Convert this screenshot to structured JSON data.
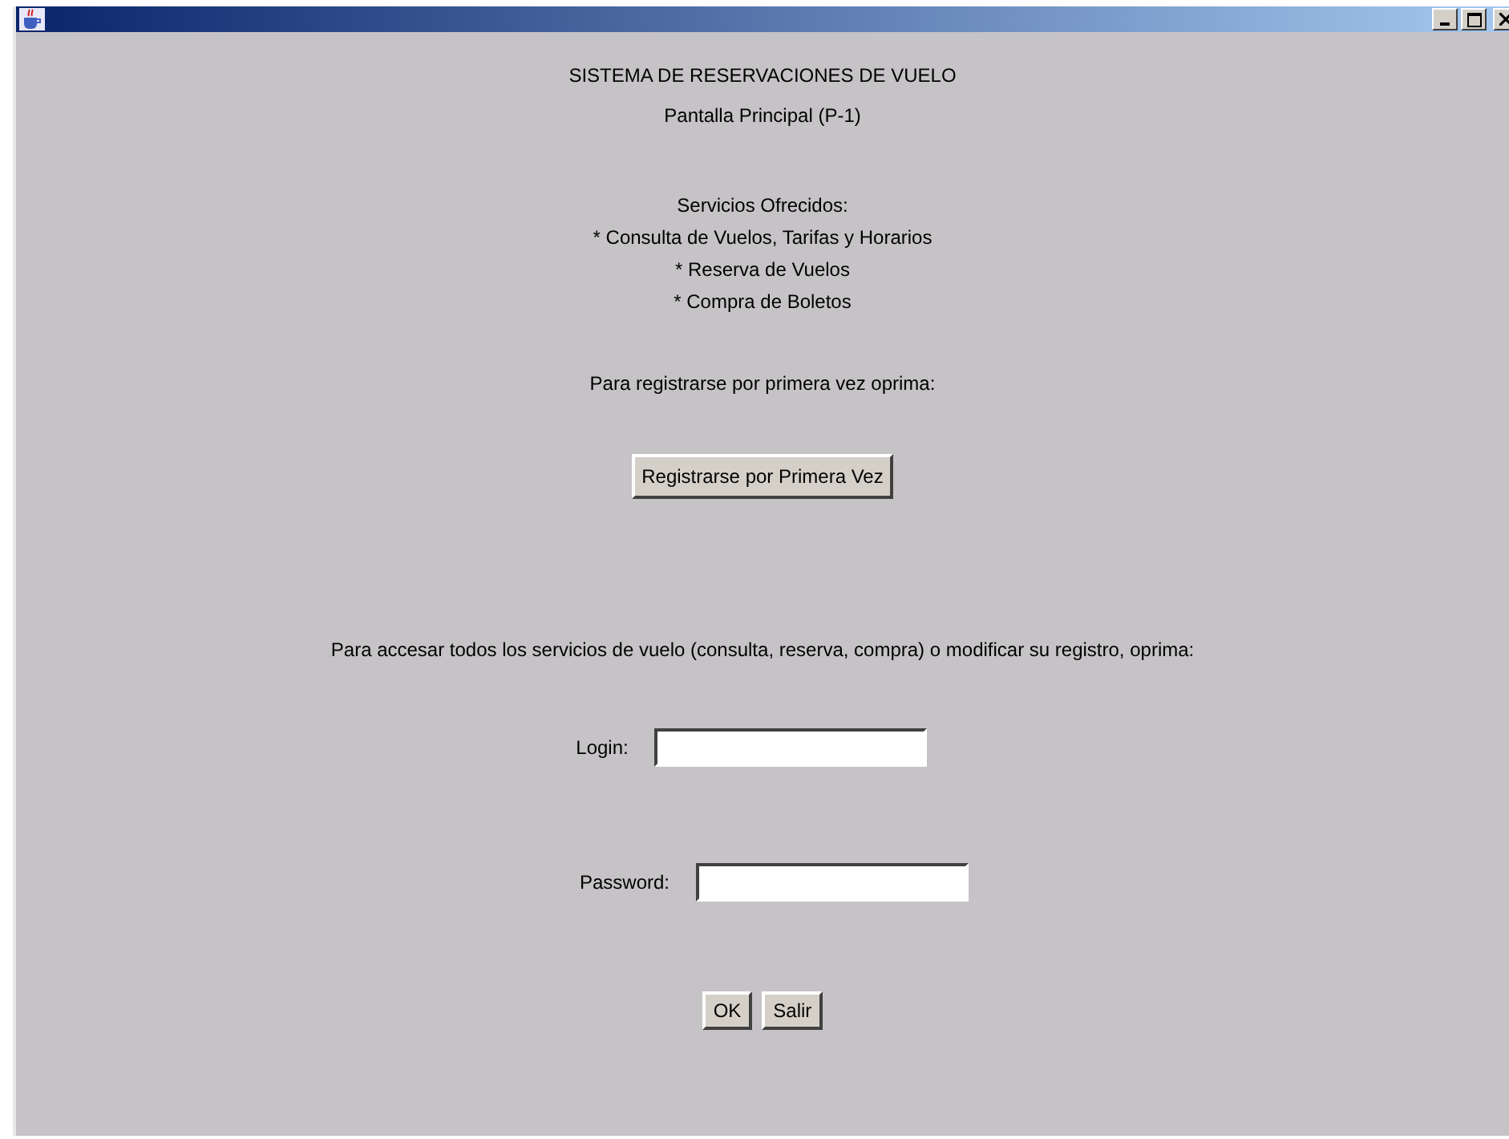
{
  "window": {
    "title_bar": {
      "controls": [
        {
          "kind": "minimize"
        },
        {
          "kind": "maximize"
        },
        {
          "kind": "close"
        }
      ]
    }
  },
  "header": {
    "title": "SISTEMA DE RESERVACIONES DE VUELO",
    "subtitle": "Pantalla Principal (P-1)"
  },
  "services": {
    "heading": "Servicios Ofrecidos:",
    "items": [
      "* Consulta de Vuelos, Tarifas y Horarios",
      "* Reserva de Vuelos",
      "* Compra de Boletos"
    ]
  },
  "register": {
    "prompt": "Para registrarse por primera vez oprima:",
    "button": "Registrarse por Primera Vez"
  },
  "access": {
    "prompt": "Para accesar todos los servicios de vuelo (consulta, reserva, compra) o modificar su registro, oprima:"
  },
  "fields": [
    {
      "label": "Login:"
    },
    {
      "label": "Password:"
    }
  ],
  "buttons": [
    "OK",
    "Salir"
  ]
}
